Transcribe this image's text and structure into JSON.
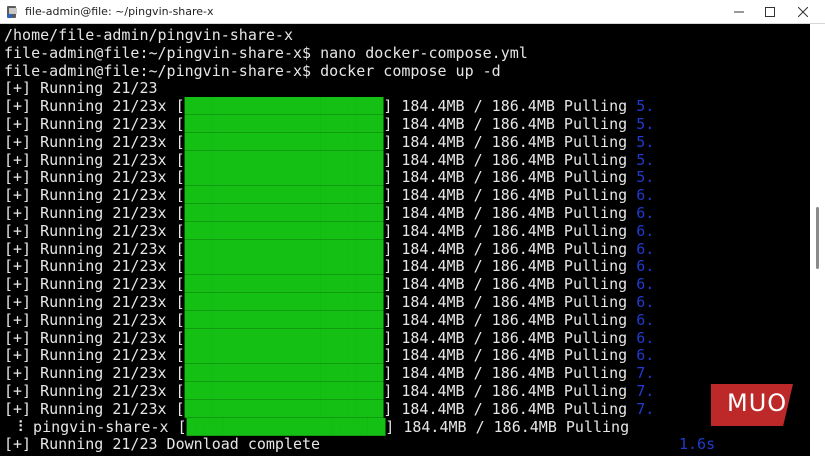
{
  "window": {
    "title": "file-admin@file: ~/pingvin-share-x",
    "minimize_glyph": "—",
    "maximize_glyph": "☐",
    "close_glyph": "✕"
  },
  "terminal": {
    "lines": [
      {
        "kind": "plain",
        "text": "/home/file-admin/pingvin-share-x"
      },
      {
        "kind": "plain",
        "text": "file-admin@file:~/pingvin-share-x$ nano docker-compose.yml"
      },
      {
        "kind": "plain",
        "text": "file-admin@file:~/pingvin-share-x$ docker compose up -d"
      },
      {
        "kind": "plain",
        "text": "[+] Running 21/23"
      },
      {
        "kind": "progress",
        "pre": "[+] Running 21/23x [",
        "bar": "██████████████████████",
        "post": "] 184.4MB / 186.4MB Pulling ",
        "tail": "5."
      },
      {
        "kind": "progress",
        "pre": "[+] Running 21/23x [",
        "bar": "██████████████████████",
        "post": "] 184.4MB / 186.4MB Pulling ",
        "tail": "5."
      },
      {
        "kind": "progress",
        "pre": "[+] Running 21/23x [",
        "bar": "██████████████████████",
        "post": "] 184.4MB / 186.4MB Pulling ",
        "tail": "5."
      },
      {
        "kind": "progress",
        "pre": "[+] Running 21/23x [",
        "bar": "██████████████████████",
        "post": "] 184.4MB / 186.4MB Pulling ",
        "tail": "5."
      },
      {
        "kind": "progress",
        "pre": "[+] Running 21/23x [",
        "bar": "██████████████████████",
        "post": "] 184.4MB / 186.4MB Pulling ",
        "tail": "5."
      },
      {
        "kind": "progress",
        "pre": "[+] Running 21/23x [",
        "bar": "██████████████████████",
        "post": "] 184.4MB / 186.4MB Pulling ",
        "tail": "6."
      },
      {
        "kind": "progress",
        "pre": "[+] Running 21/23x [",
        "bar": "██████████████████████",
        "post": "] 184.4MB / 186.4MB Pulling ",
        "tail": "6."
      },
      {
        "kind": "progress",
        "pre": "[+] Running 21/23x [",
        "bar": "██████████████████████",
        "post": "] 184.4MB / 186.4MB Pulling ",
        "tail": "6."
      },
      {
        "kind": "progress",
        "pre": "[+] Running 21/23x [",
        "bar": "██████████████████████",
        "post": "] 184.4MB / 186.4MB Pulling ",
        "tail": "6."
      },
      {
        "kind": "progress",
        "pre": "[+] Running 21/23x [",
        "bar": "██████████████████████",
        "post": "] 184.4MB / 186.4MB Pulling ",
        "tail": "6."
      },
      {
        "kind": "progress",
        "pre": "[+] Running 21/23x [",
        "bar": "██████████████████████",
        "post": "] 184.4MB / 186.4MB Pulling ",
        "tail": "6."
      },
      {
        "kind": "progress",
        "pre": "[+] Running 21/23x [",
        "bar": "██████████████████████",
        "post": "] 184.4MB / 186.4MB Pulling ",
        "tail": "6."
      },
      {
        "kind": "progress",
        "pre": "[+] Running 21/23x [",
        "bar": "██████████████████████",
        "post": "] 184.4MB / 186.4MB Pulling ",
        "tail": "6."
      },
      {
        "kind": "progress",
        "pre": "[+] Running 21/23x [",
        "bar": "██████████████████████",
        "post": "] 184.4MB / 186.4MB Pulling ",
        "tail": "6."
      },
      {
        "kind": "progress",
        "pre": "[+] Running 21/23x [",
        "bar": "██████████████████████",
        "post": "] 184.4MB / 186.4MB Pulling ",
        "tail": "6."
      },
      {
        "kind": "progress",
        "pre": "[+] Running 21/23x [",
        "bar": "██████████████████████",
        "post": "] 184.4MB / 186.4MB Pulling ",
        "tail": "7."
      },
      {
        "kind": "progress",
        "pre": "[+] Running 21/23x [",
        "bar": "██████████████████████",
        "post": "] 184.4MB / 186.4MB Pulling ",
        "tail": "7."
      },
      {
        "kind": "progress",
        "pre": "[+] Running 21/23x [",
        "bar": "██████████████████████",
        "post": "] 184.4MB / 186.4MB Pulling ",
        "tail": "7."
      },
      {
        "kind": "progress",
        "pre": " ⠸ pingvin-share-x [",
        "bar": "██████████████████████",
        "post": "] 184.4MB / 186.4MB Pulling ",
        "tail": ""
      },
      {
        "kind": "plain",
        "text": "[+] Running 21/23 Download complete",
        "tail": "1.6s"
      }
    ]
  },
  "watermark": {
    "text": "MUO"
  },
  "colors": {
    "background": "#000000",
    "foreground": "#e6e6e6",
    "progress_bar": "#14c014",
    "timer": "#1f3bd0",
    "watermark": "#d22c2c"
  }
}
